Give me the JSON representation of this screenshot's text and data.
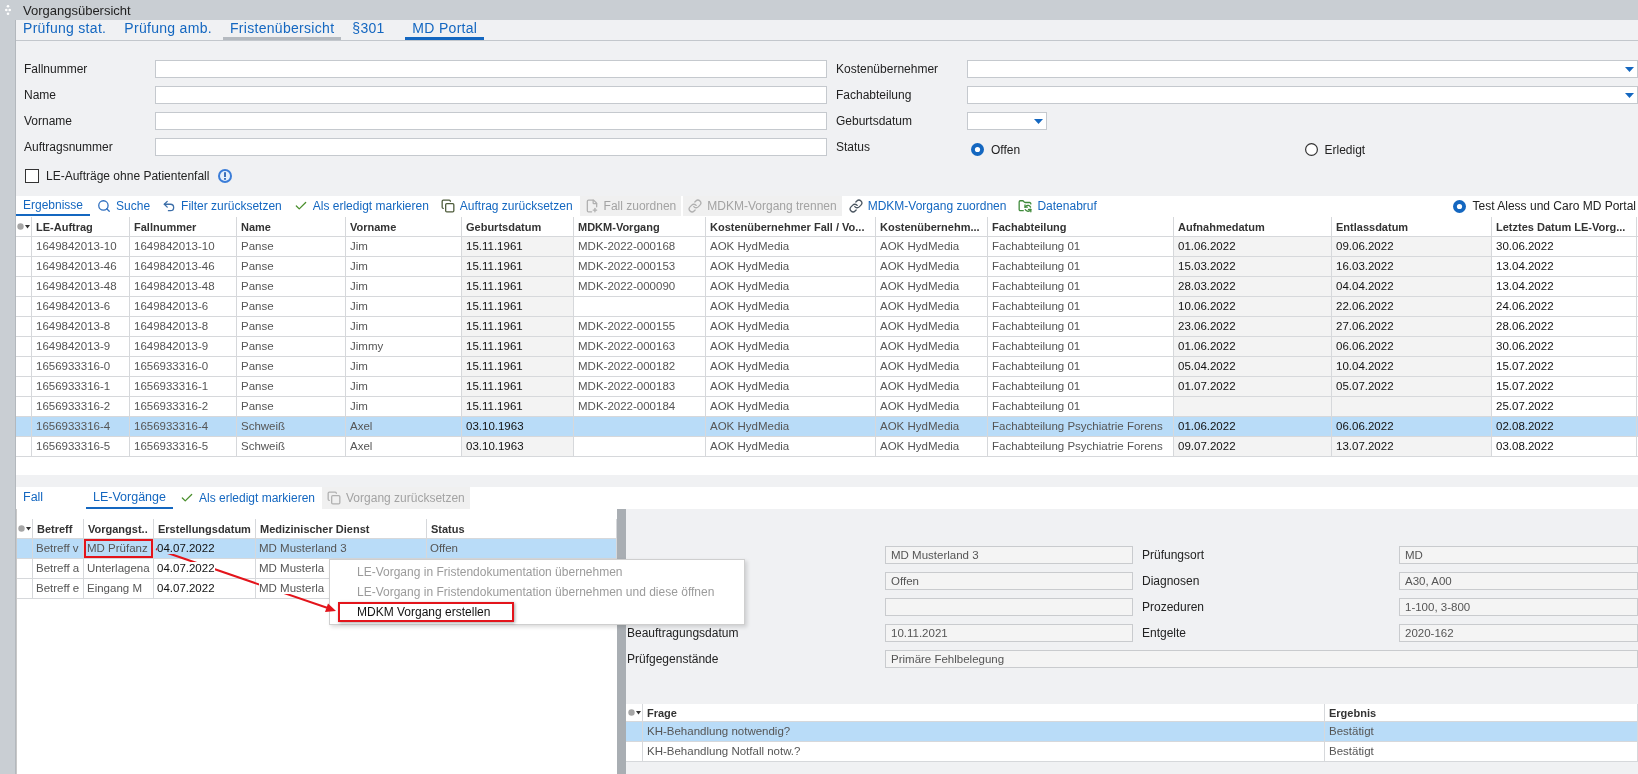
{
  "window": {
    "title": "Vorgangsübersicht"
  },
  "tabs": [
    {
      "label": "Prüfung stat.",
      "selected": false,
      "hovered": false
    },
    {
      "label": "Prüfung amb.",
      "selected": false,
      "hovered": false
    },
    {
      "label": "Fristenübersicht",
      "selected": false,
      "hovered": true
    },
    {
      "label": "§301",
      "selected": false,
      "hovered": false
    },
    {
      "label": "MD Portal",
      "selected": true,
      "hovered": false
    }
  ],
  "filter_form": {
    "left_fields": [
      {
        "label": "Fallnummer",
        "kind": "text"
      },
      {
        "label": "Name",
        "kind": "text"
      },
      {
        "label": "Vorname",
        "kind": "text"
      },
      {
        "label": "Auftragsnummer",
        "kind": "text"
      }
    ],
    "right_fields": [
      {
        "label": "Kostenübernehmer",
        "kind": "dropdown"
      },
      {
        "label": "Fachabteilung",
        "kind": "dropdown"
      },
      {
        "label": "Geburtsdatum",
        "kind": "date"
      },
      {
        "label": "Status",
        "kind": "radio",
        "options": [
          {
            "label": "Offen",
            "selected": true
          },
          {
            "label": "Erledigt",
            "selected": false
          }
        ]
      }
    ],
    "checkbox": {
      "label": "LE-Aufträge ohne Patientenfall",
      "checked": false
    }
  },
  "results_toolbar": {
    "tabs": [
      {
        "label": "Ergebnisse",
        "selected": true
      }
    ],
    "actions": [
      {
        "kind": "search",
        "label": "Suche",
        "disabled": false
      },
      {
        "kind": "undo",
        "label": "Filter zurücksetzen",
        "disabled": false
      },
      {
        "kind": "done",
        "label": "Als erledigt markieren",
        "disabled": false
      },
      {
        "kind": "revert",
        "label": "Auftrag zurücksetzen",
        "disabled": false
      },
      {
        "kind": "assign",
        "label": "Fall zuordnen",
        "disabled": true
      },
      {
        "kind": "unlink",
        "label": "MDKM-Vorgang trennen",
        "disabled": true
      },
      {
        "kind": "link",
        "label": "MDKM-Vorgang zuordnen",
        "disabled": false
      },
      {
        "kind": "fetch",
        "label": "Datenabruf",
        "disabled": false
      }
    ],
    "portal_option": {
      "label": "Test Aless und Caro MD Portal",
      "selected": true
    }
  },
  "results_table": {
    "columns": [
      {
        "label": "LE-Auftrag",
        "kind": "text"
      },
      {
        "label": "Fallnummer",
        "kind": "text"
      },
      {
        "label": "Name",
        "kind": "text"
      },
      {
        "label": "Vorname",
        "kind": "text"
      },
      {
        "label": "Geburtsdatum",
        "kind": "date_field"
      },
      {
        "label": "MDKM-Vorgang",
        "kind": "text"
      },
      {
        "label": "Kostenübernehmer Fall / Vo...",
        "kind": "text"
      },
      {
        "label": "Kostenübernehm...",
        "kind": "text"
      },
      {
        "label": "Fachabteilung",
        "kind": "text"
      },
      {
        "label": "Aufnahmedatum",
        "kind": "date_field"
      },
      {
        "label": "Entlassdatum",
        "kind": "date_field"
      },
      {
        "label": "Letztes Datum LE-Vorg...",
        "kind": "date"
      }
    ],
    "rows": [
      {
        "selected": false,
        "cells": [
          "1649842013-10",
          "1649842013-10",
          "Panse",
          "Jim",
          "15.11.1961",
          "MDK-2022-000168",
          "AOK HydMedia",
          "AOK HydMedia",
          "Fachabteilung 01",
          "01.06.2022",
          "09.06.2022",
          "30.06.2022"
        ]
      },
      {
        "selected": false,
        "cells": [
          "1649842013-46",
          "1649842013-46",
          "Panse",
          "Jim",
          "15.11.1961",
          "MDK-2022-000153",
          "AOK HydMedia",
          "AOK HydMedia",
          "Fachabteilung 01",
          "15.03.2022",
          "16.03.2022",
          "13.04.2022"
        ]
      },
      {
        "selected": false,
        "cells": [
          "1649842013-48",
          "1649842013-48",
          "Panse",
          "Jim",
          "15.11.1961",
          "MDK-2022-000090",
          "AOK HydMedia",
          "AOK HydMedia",
          "Fachabteilung 01",
          "28.03.2022",
          "04.04.2022",
          "13.04.2022"
        ]
      },
      {
        "selected": false,
        "cells": [
          "1649842013-6",
          "1649842013-6",
          "Panse",
          "Jim",
          "15.11.1961",
          null,
          "AOK HydMedia",
          "AOK HydMedia",
          "Fachabteilung 01",
          "10.06.2022",
          "22.06.2022",
          "24.06.2022"
        ]
      },
      {
        "selected": false,
        "cells": [
          "1649842013-8",
          "1649842013-8",
          "Panse",
          "Jim",
          "15.11.1961",
          "MDK-2022-000155",
          "AOK HydMedia",
          "AOK HydMedia",
          "Fachabteilung 01",
          "23.06.2022",
          "27.06.2022",
          "28.06.2022"
        ]
      },
      {
        "selected": false,
        "cells": [
          "1649842013-9",
          "1649842013-9",
          "Panse",
          "Jimmy",
          "15.11.1961",
          "MDK-2022-000163",
          "AOK HydMedia",
          "AOK HydMedia",
          "Fachabteilung 01",
          "01.06.2022",
          "06.06.2022",
          "30.06.2022"
        ]
      },
      {
        "selected": false,
        "cells": [
          "1656933316-0",
          "1656933316-0",
          "Panse",
          "Jim",
          "15.11.1961",
          "MDK-2022-000182",
          "AOK HydMedia",
          "AOK HydMedia",
          "Fachabteilung 01",
          "05.04.2022",
          "10.04.2022",
          "15.07.2022"
        ]
      },
      {
        "selected": false,
        "cells": [
          "1656933316-1",
          "1656933316-1",
          "Panse",
          "Jim",
          "15.11.1961",
          "MDK-2022-000183",
          "AOK HydMedia",
          "AOK HydMedia",
          "Fachabteilung 01",
          "01.07.2022",
          "05.07.2022",
          "15.07.2022"
        ]
      },
      {
        "selected": false,
        "cells": [
          "1656933316-2",
          "1656933316-2",
          "Panse",
          "Jim",
          "15.11.1961",
          "MDK-2022-000184",
          "AOK HydMedia",
          "AOK HydMedia",
          "Fachabteilung 01",
          null,
          null,
          "25.07.2022"
        ]
      },
      {
        "selected": true,
        "cells": [
          "1656933316-4",
          "1656933316-4",
          "Schweiß",
          "Axel",
          "03.10.1963",
          null,
          "AOK HydMedia",
          "AOK HydMedia",
          "Fachabteilung Psychiatrie Forens",
          "01.06.2022",
          "06.06.2022",
          "02.08.2022"
        ]
      },
      {
        "selected": false,
        "cells": [
          "1656933316-5",
          "1656933316-5",
          "Schweiß",
          "Axel",
          "03.10.1963",
          null,
          "AOK HydMedia",
          "AOK HydMedia",
          "Fachabteilung Psychiatrie Forens",
          "09.07.2022",
          "13.07.2022",
          "03.08.2022"
        ]
      }
    ]
  },
  "detail_toolbar": {
    "tabs": [
      {
        "label": "Fall",
        "selected": false
      },
      {
        "label": "LE-Vorgänge",
        "selected": true
      }
    ],
    "actions": [
      {
        "kind": "done",
        "label": "Als erledigt markieren",
        "disabled": false
      },
      {
        "kind": "revert",
        "label": "Vorgang zurücksetzen",
        "disabled": true
      }
    ]
  },
  "case_table": {
    "columns": [
      {
        "label": "Betreff",
        "kind": "text"
      },
      {
        "label": "Vorgangst..",
        "kind": "text"
      },
      {
        "label": "Erstellungsdatum",
        "kind": "date"
      },
      {
        "label": "Medizinischer Dienst",
        "kind": "text"
      },
      {
        "label": "Status",
        "kind": "text"
      }
    ],
    "rows": [
      {
        "selected": true,
        "cells": [
          {
            "text": "Betreff v",
            "highlighted": false
          },
          {
            "text": "MD Prüfanz",
            "highlighted": true
          },
          {
            "text": "04.07.2022",
            "highlighted": false
          },
          {
            "text": "MD Musterland 3",
            "highlighted": false
          },
          {
            "text": "Offen",
            "highlighted": false
          }
        ]
      },
      {
        "selected": false,
        "cells": [
          {
            "text": "Betreff a",
            "highlighted": false
          },
          {
            "text": "Unterlagena",
            "highlighted": false
          },
          {
            "text": "04.07.2022",
            "highlighted": false
          },
          {
            "text": "MD Musterla",
            "highlighted": false
          }
        ]
      },
      {
        "selected": false,
        "cells": [
          {
            "text": "Betreff e",
            "highlighted": false
          },
          {
            "text": "Eingang M",
            "highlighted": false
          },
          {
            "text": "04.07.2022",
            "highlighted": false
          },
          {
            "text": "MD Musterla",
            "highlighted": false
          }
        ]
      }
    ]
  },
  "context_menu": {
    "items": [
      {
        "label": "LE-Vorgang in Fristendokumentation übernehmen",
        "disabled": true,
        "highlighted": false
      },
      {
        "label": "LE-Vorgang in Fristendokumentation übernehmen und diese öffnen",
        "disabled": true,
        "highlighted": false
      },
      {
        "label": "MDKM Vorgang erstellen",
        "disabled": false,
        "highlighted": true
      }
    ]
  },
  "details": {
    "rows": [
      {
        "kind": "pair",
        "left": {
          "value": "MD Musterland 3"
        },
        "right": {
          "label": "Prüfungsort",
          "value": "MD"
        }
      },
      {
        "kind": "pair",
        "left": {
          "value": "Offen"
        },
        "right": {
          "label": "Diagnosen",
          "value": "A30, A00"
        }
      },
      {
        "kind": "pair",
        "right": {
          "label": "Prozeduren",
          "value": "1-100, 3-800"
        }
      },
      {
        "kind": "pair",
        "left": {
          "label": "Beauftragungsdatum",
          "value": "10.11.2021"
        },
        "right": {
          "label": "Entgelte",
          "value": "2020-162"
        }
      },
      {
        "kind": "wide",
        "left": {
          "label": "Prüfgegenstände",
          "value": "Primäre Fehlbelegung"
        }
      }
    ]
  },
  "questions_table": {
    "columns": [
      {
        "label": "Frage"
      },
      {
        "label": "Ergebnis"
      }
    ],
    "rows": [
      {
        "selected": true,
        "cells": [
          "KH-Behandlung notwendig?",
          "Bestätigt"
        ]
      },
      {
        "selected": false,
        "cells": [
          "KH-Behandlung Notfall notw.?",
          "Bestätigt"
        ]
      }
    ]
  }
}
